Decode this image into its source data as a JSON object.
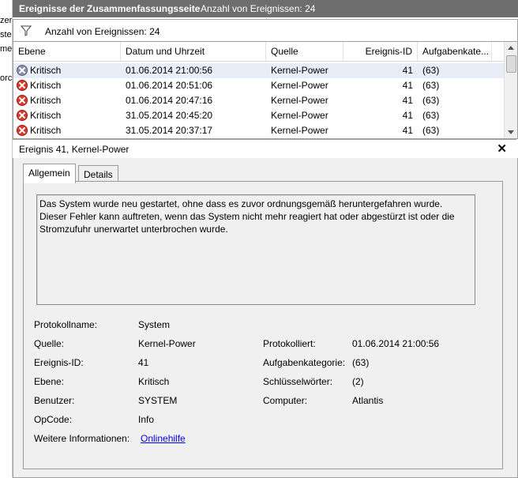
{
  "left_strip": {
    "fragments": [
      "zer",
      "ste",
      "mer",
      "orc"
    ]
  },
  "titlebar": {
    "title": "Ereignisse der Zusammenfassungsseite",
    "count_label": "Anzahl von Ereignissen: 24"
  },
  "filter": {
    "icon": "filter-icon",
    "label": "Anzahl von Ereignissen: 24"
  },
  "grid": {
    "columns": [
      "Ebene",
      "Datum und Uhrzeit",
      "Quelle",
      "Ereignis-ID",
      "Aufgabenkate..."
    ],
    "rows": [
      {
        "level": "Kritisch",
        "datetime": "01.06.2014 21:00:56",
        "source": "Kernel-Power",
        "id": "41",
        "category": "(63)"
      },
      {
        "level": "Kritisch",
        "datetime": "01.06.2014 20:51:06",
        "source": "Kernel-Power",
        "id": "41",
        "category": "(63)"
      },
      {
        "level": "Kritisch",
        "datetime": "01.06.2014 20:47:16",
        "source": "Kernel-Power",
        "id": "41",
        "category": "(63)"
      },
      {
        "level": "Kritisch",
        "datetime": "31.05.2014 20:45:20",
        "source": "Kernel-Power",
        "id": "41",
        "category": "(63)"
      },
      {
        "level": "Kritisch",
        "datetime": "31.05.2014 20:37:17",
        "source": "Kernel-Power",
        "id": "41",
        "category": "(63)"
      }
    ]
  },
  "detail": {
    "title": "Ereignis 41, Kernel-Power",
    "close_glyph": "✕",
    "tabs": [
      "Allgemein",
      "Details"
    ],
    "message": "Das System wurde neu gestartet, ohne dass es zuvor ordnungsgemäß heruntergefahren wurde. Dieser Fehler kann auftreten, wenn das System nicht mehr reagiert hat oder abgestürzt ist oder die Stromzufuhr unerwartet unterbrochen wurde.",
    "fields": {
      "protokollname_label": "Protokollname:",
      "protokollname_value": "System",
      "quelle_label": "Quelle:",
      "quelle_value": "Kernel-Power",
      "protokolliert_label": "Protokolliert:",
      "protokolliert_value": "01.06.2014 21:00:56",
      "ereignis_id_label": "Ereignis-ID:",
      "ereignis_id_value": "41",
      "aufgabenkategorie_label": "Aufgabenkategorie:",
      "aufgabenkategorie_value": "(63)",
      "ebene_label": "Ebene:",
      "ebene_value": "Kritisch",
      "schluesselwoerter_label": "Schlüsselwörter:",
      "schluesselwoerter_value": "(2)",
      "benutzer_label": "Benutzer:",
      "benutzer_value": "SYSTEM",
      "computer_label": "Computer:",
      "computer_value": "Atlantis",
      "opcode_label": "OpCode:",
      "opcode_value": "Info",
      "weitere_label": "Weitere Informationen:",
      "weitere_link": "Onlinehilfe"
    }
  },
  "colors": {
    "titlebar_bg": "#6e6e6e",
    "critical_icon": "#d93a2b",
    "link": "#0000ee"
  }
}
